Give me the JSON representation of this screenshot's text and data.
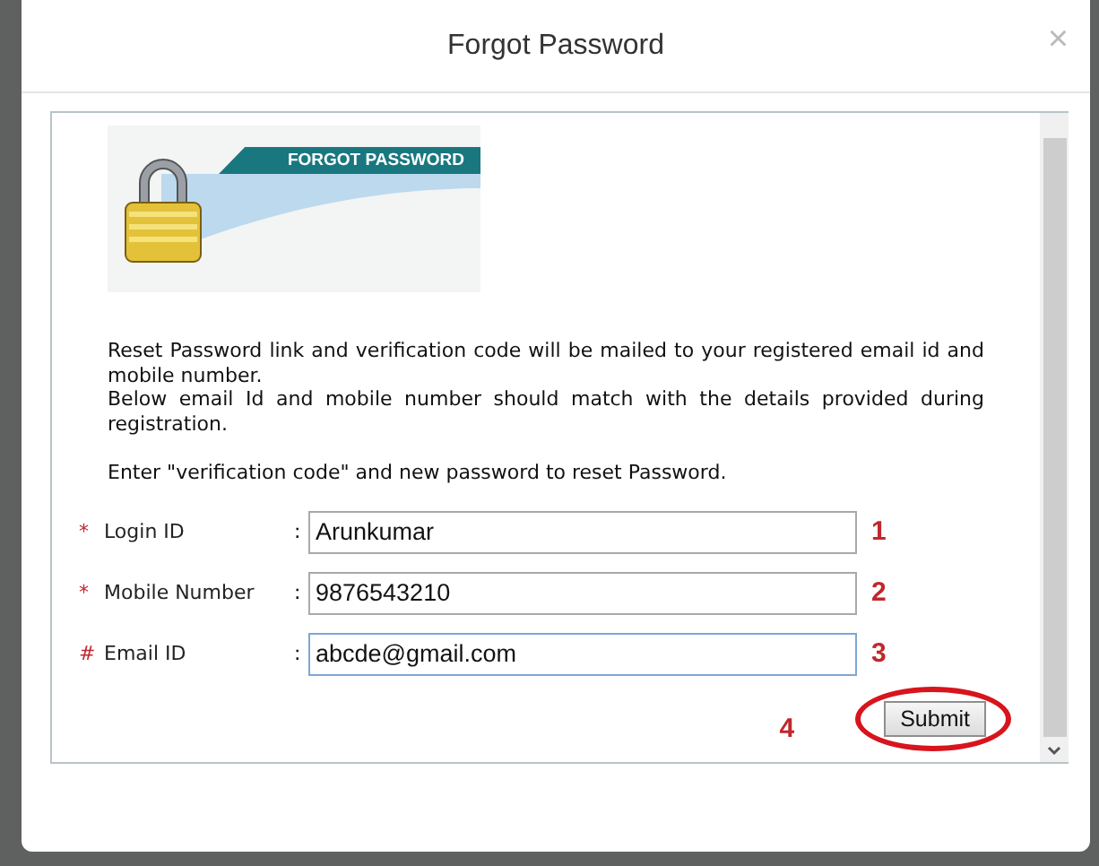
{
  "dialog": {
    "title": "Forgot Password",
    "close": "×",
    "banner": {
      "text": "FORGOT PASSWORD"
    },
    "info": [
      "Reset Password link and verification code will be mailed to your registered email id and mobile number.",
      "Below email Id and mobile number should match with the details provided during registration.",
      "Enter \"verification code\" and new password to reset Password."
    ],
    "fields": [
      {
        "mark": "*",
        "label": "Login ID",
        "colon": ":",
        "value": "Arunkumar",
        "step": "1",
        "focused": false
      },
      {
        "mark": "*",
        "label": "Mobile Number",
        "colon": ":",
        "value": "9876543210",
        "step": "2",
        "focused": false
      },
      {
        "mark": "#",
        "label": "Email ID",
        "colon": ":",
        "value": "abcde@gmail.com",
        "step": "3",
        "focused": true
      }
    ],
    "submit": {
      "label": "Submit",
      "step": "4",
      "highlighted": true
    }
  }
}
